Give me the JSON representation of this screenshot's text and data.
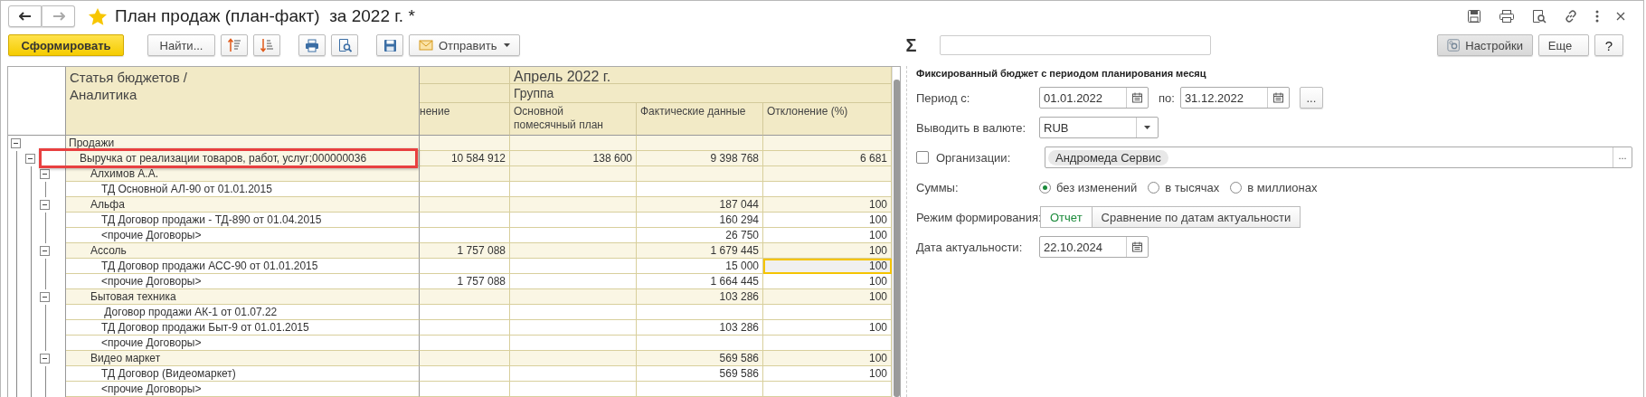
{
  "window": {
    "title": "План продаж (план-факт)  за 2022 г. *",
    "favorite": true
  },
  "toolbar": {
    "generate_button": "Сформировать",
    "find_button": "Найти...",
    "send_button": "Отправить",
    "sum_label": "Σ",
    "settings_button": "Настройки",
    "more_button": "Еще",
    "help_button": "?"
  },
  "table": {
    "header": {
      "analytics": [
        "Статья бюджетов /",
        "Аналитика"
      ],
      "period": "Апрель 2022 г.",
      "group": "Группа",
      "columns": [
        [
          "нение"
        ],
        [
          "Основной",
          "помесячный план"
        ],
        [
          "Фактические данные"
        ],
        [
          "Отклонение (%)"
        ]
      ]
    },
    "rows": [
      {
        "label": "Продажи",
        "expanded": true,
        "selected": false,
        "children": [
          {
            "label": "Выручка от реализации товаров, работ, услуг;000000036",
            "expanded": true,
            "highlighted": true,
            "selected": false,
            "column_1": "10 584 912",
            "plan": "138 600",
            "actual": "9 398 768",
            "deviation": "6 681",
            "children": [
              {
                "label": "Алхимов А.А.",
                "expanded": true,
                "selected": false,
                "children": [
                  {
                    "label": "ТД Основной АЛ-90 от 01.01.2015",
                    "selected": false
                  }
                ]
              },
              {
                "label": "Альфа",
                "expanded": true,
                "selected": false,
                "actual": "187 044",
                "deviation": "100",
                "children": [
                  {
                    "label": "ТД Договор продажи - ТД-890 от 01.04.2015",
                    "selected": false,
                    "actual": "160 294",
                    "deviation": "100"
                  },
                  {
                    "label": "<прочие Договоры>",
                    "selected": false,
                    "actual": "26 750",
                    "deviation": "100"
                  }
                ]
              },
              {
                "label": "Ассоль",
                "expanded": true,
                "selected": false,
                "column_1": "1 757 088",
                "actual": "1 679 445",
                "deviation": "100",
                "children": [
                  {
                    "label": "ТД Договор продажи АСС-90 от 01.01.2015",
                    "selected": true,
                    "actual": "15 000",
                    "deviation": "100"
                  },
                  {
                    "label": "<прочие Договоры>",
                    "selected": false,
                    "column_1": "1 757 088",
                    "actual": "1 664 445",
                    "deviation": "100"
                  }
                ]
              },
              {
                "label": "Бытовая техника",
                "expanded": true,
                "selected": false,
                "actual": "103 286",
                "deviation": "100",
                "children": [
                  {
                    "label": " Договор продажи АК-1 от 01.07.22",
                    "selected": false
                  },
                  {
                    "label": "ТД Договор продажи Быт-9 от 01.01.2015",
                    "selected": false,
                    "actual": "103 286",
                    "deviation": "100"
                  },
                  {
                    "label": "<прочие Договоры>",
                    "selected": false
                  }
                ]
              },
              {
                "label": "Видео маркет",
                "expanded": true,
                "selected": false,
                "actual": "569 586",
                "deviation": "100",
                "children": [
                  {
                    "label": "ТД Договор (Видеомаркет)",
                    "selected": false,
                    "actual": "569 586",
                    "deviation": "100"
                  },
                  {
                    "label": "<прочие Договоры>",
                    "selected": false
                  }
                ]
              }
            ]
          }
        ]
      }
    ]
  },
  "form": {
    "title": "Фиксированный бюджет с периодом планирования месяц",
    "period_from_label": "Период с:",
    "period_from": "01.01.2022",
    "period_to_label": "по:",
    "period_to": "31.12.2022",
    "period_button": "...",
    "currency_label": "Выводить в валюте:",
    "currency": "RUB",
    "organizations": {
      "label": "Организации:",
      "checked": false,
      "tags": [
        "Андромеда Сервис"
      ],
      "button": "..."
    },
    "sums_label": "Суммы:",
    "sums": [
      {
        "label": "без изменений",
        "selected": true
      },
      {
        "label": "в тысячах",
        "selected": false
      },
      {
        "label": "в миллионах",
        "selected": false
      }
    ],
    "mode_label": "Режим формирования:",
    "modes": [
      {
        "label": "Отчет",
        "selected": true
      },
      {
        "label": "Сравнение по датам актуальности",
        "selected": false
      }
    ],
    "date_label": "Дата актуальности:",
    "date": "22.10.2024"
  }
}
